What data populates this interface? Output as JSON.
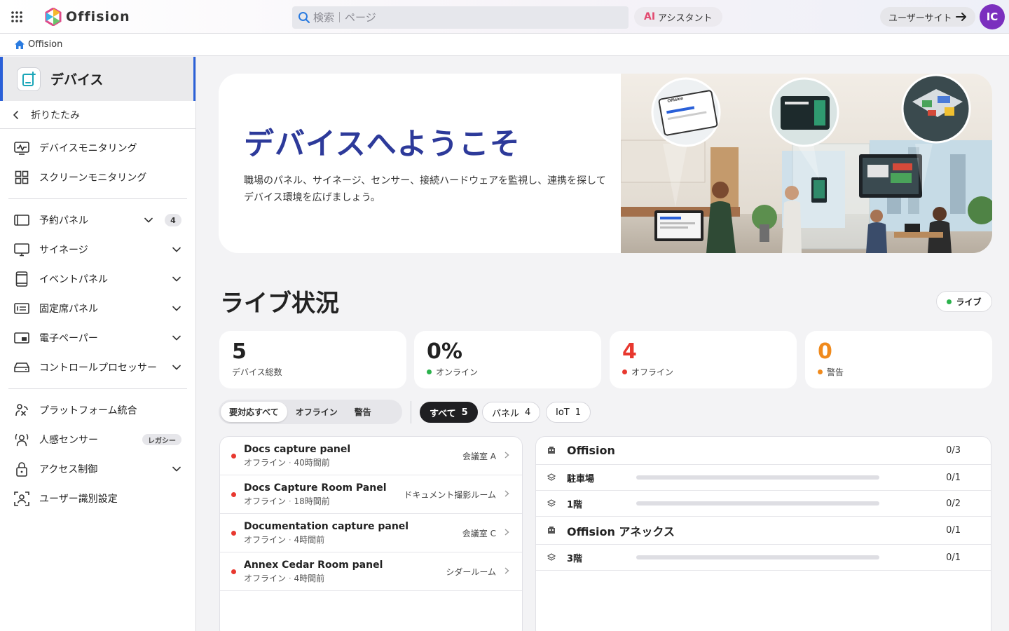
{
  "topbar": {
    "app_name": "Offision",
    "search_placeholder": "検索｜ページ",
    "ai_mark": "AI",
    "ai_label": "アシスタント",
    "user_site_label": "ユーザーサイト",
    "avatar_initials": "IC",
    "avatar_color": "#7b2fbe"
  },
  "breadcrumb": {
    "home": "Offision"
  },
  "sidebar": {
    "title": "デバイス",
    "collapse_label": "折りたたみ",
    "items": [
      {
        "label": "デバイスモニタリング",
        "icon": "monitoring-icon"
      },
      {
        "label": "スクリーンモニタリング",
        "icon": "grid-icon"
      },
      {
        "label": "予約パネル",
        "icon": "panel-icon",
        "count": "4"
      },
      {
        "label": "サイネージ",
        "icon": "monitor-icon"
      },
      {
        "label": "イベントパネル",
        "icon": "tablet-icon"
      },
      {
        "label": "固定席パネル",
        "icon": "desk-panel-icon"
      },
      {
        "label": "電子ペーパー",
        "icon": "epaper-icon"
      },
      {
        "label": "コントロールプロセッサー",
        "icon": "processor-icon"
      },
      {
        "label": "プラットフォーム統合",
        "icon": "integration-icon"
      },
      {
        "label": "人感センサー",
        "icon": "sensor-icon",
        "badge": "レガシー"
      },
      {
        "label": "アクセス制御",
        "icon": "lock-icon"
      },
      {
        "label": "ユーザー識別設定",
        "icon": "face-scan-icon"
      }
    ]
  },
  "hero": {
    "title": "デバイスへようこそ",
    "description": "職場のパネル、サイネージ、センサー、接続ハードウェアを監視し、連携を探してデバイス環境を広げましょう。",
    "screen_brand": "Offision"
  },
  "live": {
    "title": "ライブ状況",
    "badge": "ライブ",
    "stats": [
      {
        "value": "5",
        "label": "デバイス総数",
        "color": "#222222"
      },
      {
        "value": "0%",
        "label": "オンライン",
        "color": "#222222",
        "dot": "#2bb24c"
      },
      {
        "value": "4",
        "label": "オフライン",
        "color": "#e8382f",
        "dot": "#e8382f"
      },
      {
        "value": "0",
        "label": "警告",
        "color": "#f08a1c",
        "dot": "#f08a1c"
      }
    ]
  },
  "filters": {
    "segments": [
      "要対応すべて",
      "オフライン",
      "警告"
    ],
    "chips": [
      {
        "label": "すべて",
        "count": "5"
      },
      {
        "label": "パネル",
        "count": "4"
      },
      {
        "label": "IoT",
        "count": "1"
      }
    ]
  },
  "devices": [
    {
      "name": "Docs capture panel",
      "status": "オフライン",
      "sep": "·",
      "time": "40時間前",
      "location": "会議室 A"
    },
    {
      "name": "Docs Capture Room Panel",
      "status": "オフライン",
      "sep": "·",
      "time": "18時間前",
      "location": "ドキュメント撮影ルーム"
    },
    {
      "name": "Documentation capture panel",
      "status": "オフライン",
      "sep": "·",
      "time": "4時間前",
      "location": "会議室 C"
    },
    {
      "name": "Annex Cedar Room panel",
      "status": "オフライン",
      "sep": "·",
      "time": "4時間前",
      "location": "シダールーム"
    }
  ],
  "locations": {
    "buildings": [
      {
        "name": "Offision",
        "ratio": "0/3",
        "floors": [
          {
            "name": "駐車場",
            "ratio": "0/1",
            "progress": 0
          },
          {
            "name": "1階",
            "ratio": "0/2",
            "progress": 0
          }
        ]
      },
      {
        "name": "Offision アネックス",
        "ratio": "0/1",
        "floors": [
          {
            "name": "3階",
            "ratio": "0/1",
            "progress": 0
          }
        ]
      }
    ]
  }
}
